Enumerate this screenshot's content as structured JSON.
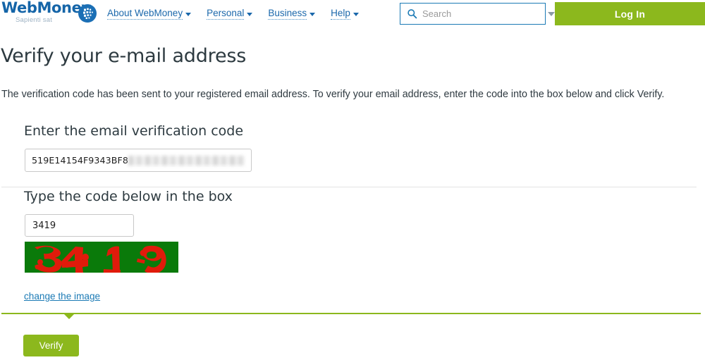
{
  "header": {
    "logo": {
      "word": "WebMoney",
      "tagline": "Sapienti sat",
      "icon": "webmoney-globe-icon"
    },
    "nav": [
      {
        "label": "About WebMoney"
      },
      {
        "label": "Personal"
      },
      {
        "label": "Business"
      },
      {
        "label": "Help"
      }
    ],
    "search": {
      "placeholder": "Search",
      "value": "",
      "icon": "search-icon",
      "dropdown_icon": "chevron-down-icon"
    },
    "login_label": "Log In",
    "colors": {
      "brand_blue": "#1565a8",
      "link_blue": "#1b68ab",
      "accent_green": "#8cb81d",
      "search_border": "#1b7ab5"
    }
  },
  "page": {
    "title": "Verify your e-mail address",
    "intro": "The verification code has been sent to your registered email address. To verify your email address, enter the code into the box below and click Verify."
  },
  "form": {
    "code_section": {
      "label": "Enter the email verification code",
      "value": "519E14154F9343BF8",
      "redacted": true
    },
    "captcha_section": {
      "label": "Type the code below in the box",
      "value": "3419",
      "captcha_text": "3419",
      "captcha_bg_color": "#0a7a0a",
      "captcha_fg_color": "#e01b0b",
      "change_image_label": "change the image"
    },
    "submit_label": "Verify"
  }
}
